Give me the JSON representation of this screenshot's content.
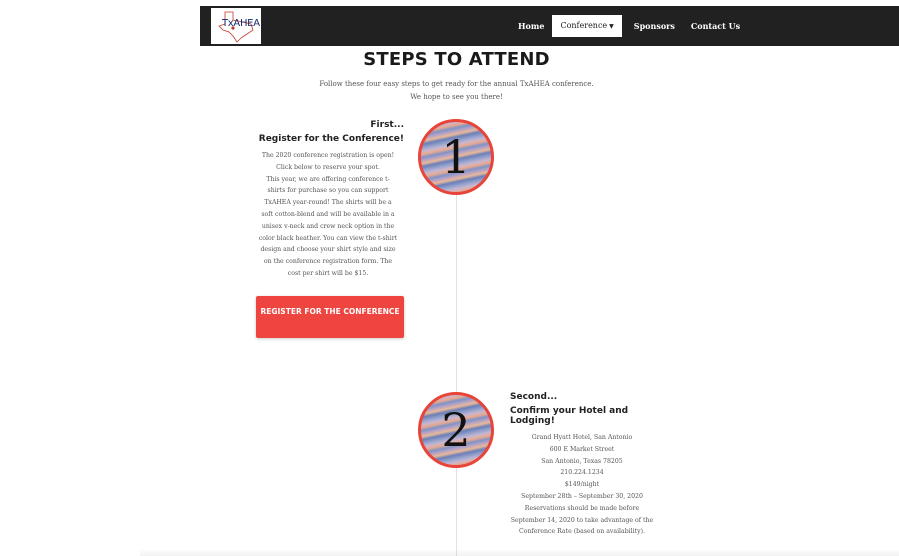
{
  "nav": {
    "logo_text": "TxAHEA",
    "items": [
      {
        "label": "Home"
      },
      {
        "label": "Conference",
        "caret": "▼"
      },
      {
        "label": "Sponsors"
      },
      {
        "label": "Contact Us"
      }
    ]
  },
  "page": {
    "title": "STEPS TO ATTEND",
    "intro_line1": "Follow these four easy steps to get ready for the annual TxAHEA conference.",
    "intro_line2": "We hope to see you there!"
  },
  "steps": [
    {
      "number": "1",
      "label": "First...",
      "heading": "Register for the Conference!",
      "lines": [
        "The 2020 conference registration is open!",
        "Click below to reserve your spot.",
        "This year, we are offering conference t-",
        "shirts for purchase so you can support",
        "TxAHEA year-round! The shirts will be a",
        "soft cotton-blend and will be available in a",
        "unisex v-neck and crew neck option in the",
        "color black heather. You can view the t-shirt",
        "design and choose your shirt style and size",
        "on the conference registration form. The",
        "cost per shirt will be $15."
      ],
      "button_label": "REGISTER FOR THE CONFERENCE"
    },
    {
      "number": "2",
      "label": "Second...",
      "heading": "Confirm your Hotel and Lodging!",
      "lines": [
        "Grand Hyatt Hotel, San Antonio",
        "600 E Market Street",
        "San Antonio, Texas 78205",
        "210.224.1234",
        "$149/night",
        "September 28th – September 30, 2020",
        "Reservations should be made before",
        "September 14, 2020 to take advantage of the",
        "Conference Rate (based on availability)."
      ]
    }
  ],
  "colors": {
    "navbar_bg": "#212121",
    "accent_red": "#ee4540",
    "circle_border": "#e8443a"
  }
}
